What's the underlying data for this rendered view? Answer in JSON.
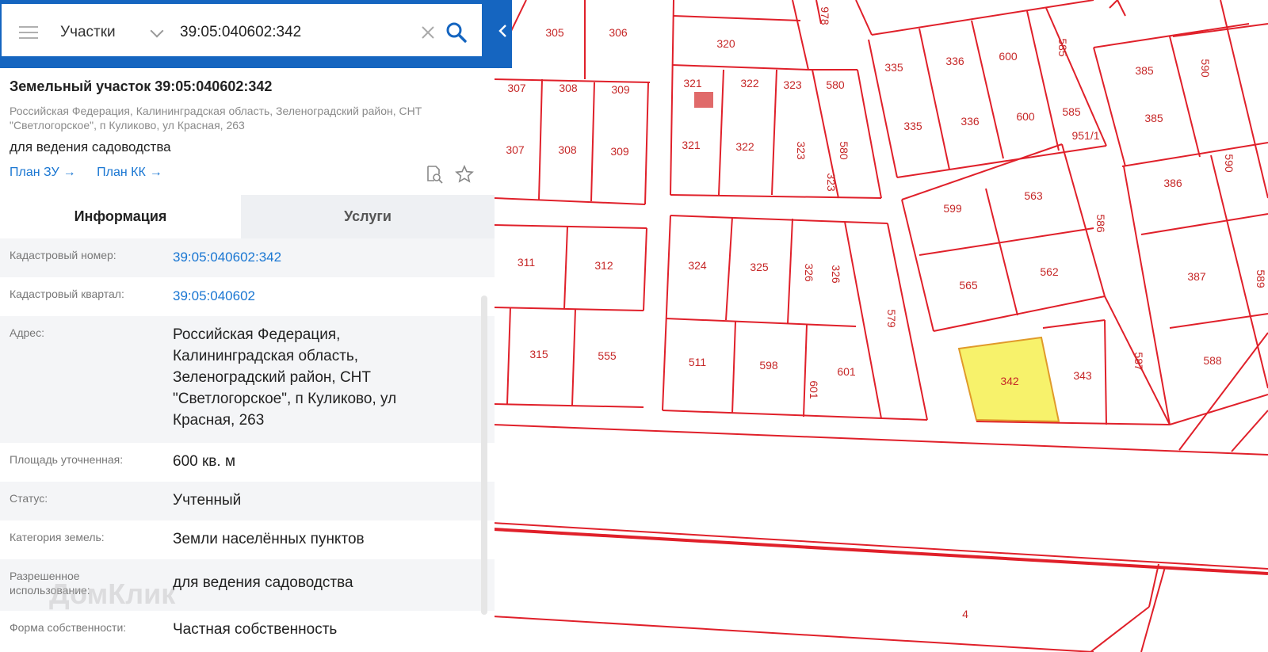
{
  "search": {
    "layer": "Участки",
    "query": "39:05:040602:342"
  },
  "parcel": {
    "title": "Земельный участок 39:05:040602:342",
    "address_short": "Российская Федерация, Калининградская область, Зеленоградский район, СНТ \"Светлогорское\", п Куликово, ул Красная, 263",
    "purpose": "для ведения садоводства",
    "link_zu": "План ЗУ",
    "link_kk": "План КК",
    "arrow": "→"
  },
  "tabs": {
    "info": "Информация",
    "services": "Услуги"
  },
  "rows": [
    {
      "label": "Кадастровый номер:",
      "value": "39:05:040602:342"
    },
    {
      "label": "Кадастровый квартал:",
      "value": "39:05:040602"
    },
    {
      "label": "Адрес:",
      "value": "Российская Федерация, Калининградская область, Зеленоградский район, СНТ \"Светлогорское\", п Куликово, ул Красная, 263"
    },
    {
      "label": "Площадь уточненная:",
      "value": "600 кв. м"
    },
    {
      "label": "Статус:",
      "value": "Учтенный"
    },
    {
      "label": "Категория земель:",
      "value": "Земли населённых пунктов"
    },
    {
      "label": "Разрешенное использование:",
      "value": "для ведения садоводства"
    },
    {
      "label": "Форма собственности:",
      "value": "Частная собственность"
    }
  ],
  "watermark": "ДомКлик",
  "icons": {
    "menu": "menu-icon",
    "dropdown": "chevron-down-icon",
    "clear": "close-icon",
    "search": "search-icon",
    "collapse": "chevron-left-icon",
    "document": "document-search-icon",
    "favorite": "star-icon"
  },
  "colors": {
    "header_blue": "#1565c0",
    "link_blue": "#1976d2",
    "parcel_line": "#e0202a",
    "selected_fill": "#f7f26b",
    "label_red": "#c62828"
  },
  "map": {
    "parcel_numbers": [
      "305",
      "306",
      "320",
      "978",
      "335",
      "336",
      "600",
      "585",
      "385",
      "590",
      "307",
      "308",
      "309",
      "321",
      "322",
      "323",
      "580",
      "335",
      "336",
      "600",
      "585",
      "385",
      "951/1",
      "307",
      "308",
      "309",
      "321",
      "322",
      "323",
      "580",
      "386",
      "590",
      "323",
      "599",
      "563",
      "586",
      "311",
      "312",
      "324",
      "325",
      "326",
      "326",
      "565",
      "562",
      "387",
      "589",
      "579",
      "315",
      "555",
      "511",
      "598",
      "601",
      "601",
      "342",
      "343",
      "587",
      "588",
      "4"
    ],
    "selected_parcel": "342"
  }
}
